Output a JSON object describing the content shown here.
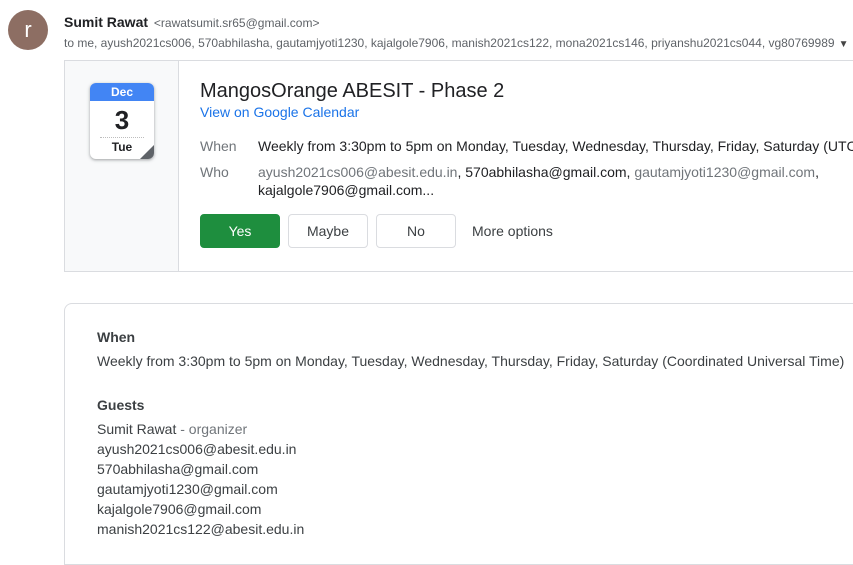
{
  "sender": {
    "avatar_letter": "r",
    "name": "Sumit Rawat",
    "email": "<rawatsumit.sr65@gmail.com>",
    "to_line": "to me, ayush2021cs006, 570abhilasha, gautamjyoti1230, kajalgole7906, manish2021cs122, mona2021cs146, priyanshu2021cs044, vg80769989"
  },
  "calendar_icon": {
    "month": "Dec",
    "day": "3",
    "weekday": "Tue"
  },
  "event": {
    "title": "MangosOrange ABESIT - Phase 2",
    "link": "View on Google Calendar",
    "when_label": "When",
    "when_value": "Weekly from 3:30pm to 5pm on Monday, Tuesday, Wednesday, Thursday, Friday, Saturday (UTC",
    "who_label": "Who",
    "who_1": "ayush2021cs006@abesit.edu.in",
    "who_2": ", 570abhilasha@gmail.com, ",
    "who_3": "gautamjyoti1230@gmail.com",
    "who_4": ",",
    "who_5": "kajalgole7906@gmail.com..."
  },
  "rsvp": {
    "yes": "Yes",
    "maybe": "Maybe",
    "no": "No",
    "more": "More options"
  },
  "details": {
    "when_heading": "When",
    "when_text": "Weekly from 3:30pm to 5pm on Monday, Tuesday, Wednesday, Thursday, Friday, Saturday (Coordinated Universal Time)",
    "guests_heading": "Guests",
    "organizer_name": "Sumit Rawat",
    "organizer_role": " - organizer",
    "guests": [
      "ayush2021cs006@abesit.edu.in",
      "570abhilasha@gmail.com",
      "gautamjyoti1230@gmail.com",
      "kajalgole7906@gmail.com",
      "manish2021cs122@abesit.edu.in"
    ]
  }
}
